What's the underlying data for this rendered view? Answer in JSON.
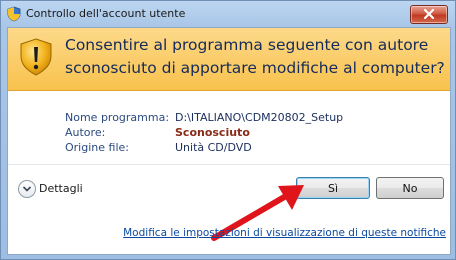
{
  "window": {
    "title": "Controllo dell'account utente",
    "close_icon": "close-icon"
  },
  "prompt": {
    "heading_line1": "Consentire al programma seguente con autore",
    "heading_line2": "sconosciuto di apportare modifiche al computer?",
    "icon": "uac-shield-warning-icon",
    "band_color": "#f8c24d"
  },
  "details": {
    "program_name_label": "Nome programma:",
    "program_name_value": "D:\\ITALIANO\\CDM20802_Setup",
    "publisher_label": "Autore:",
    "publisher_value": "Sconosciuto",
    "origin_label": "Origine file:",
    "origin_value": "Unità CD/DVD"
  },
  "footer": {
    "details_toggle_label": "Dettagli",
    "yes_label": "Sì",
    "no_label": "No",
    "settings_link": "Modifica le impostazioni di visualizzazione di queste notifiche"
  },
  "annotation": {
    "arrow_color": "#e0141b",
    "arrow_target": "yes-button"
  }
}
